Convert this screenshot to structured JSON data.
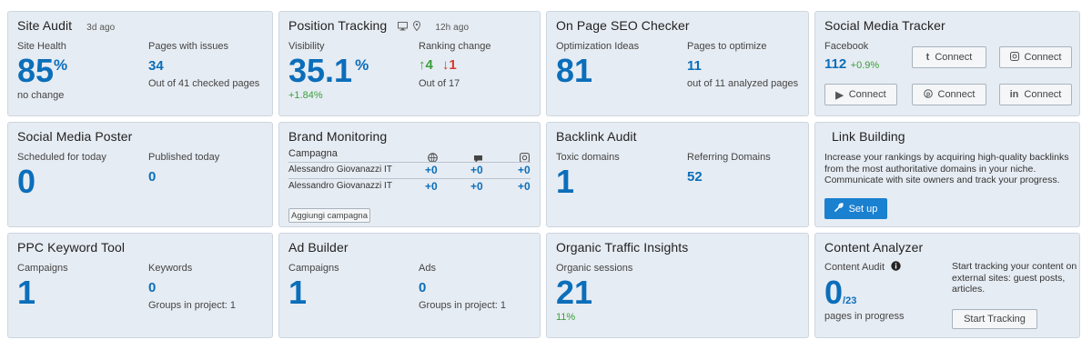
{
  "site_audit": {
    "title": "Site Audit",
    "meta": "3d ago",
    "health_label": "Site Health",
    "health_value": "85",
    "health_unit": "%",
    "health_change": "no change",
    "issues_label": "Pages with issues",
    "issues_value": "34",
    "issues_sub": "Out of 41 checked pages"
  },
  "position_tracking": {
    "title": "Position Tracking",
    "meta": "12h ago",
    "visibility_label": "Visibility",
    "visibility_value": "35.1",
    "visibility_unit": "%",
    "visibility_change": "+1.84%",
    "ranking_label": "Ranking change",
    "up_value": "4",
    "down_value": "1",
    "ranking_sub": "Out of 17"
  },
  "onpage": {
    "title": "On Page SEO Checker",
    "ideas_label": "Optimization Ideas",
    "ideas_value": "81",
    "pages_label": "Pages to optimize",
    "pages_value": "11",
    "pages_sub": "out of 11 analyzed pages"
  },
  "social_tracker": {
    "title": "Social Media Tracker",
    "facebook_label": "Facebook",
    "facebook_value": "112",
    "facebook_change": "+0.9%",
    "buttons": [
      "Connect",
      "Connect",
      "Connect",
      "Connect",
      "Connect"
    ]
  },
  "social_poster": {
    "title": "Social Media Poster",
    "scheduled_label": "Scheduled for today",
    "scheduled_value": "0",
    "published_label": "Published today",
    "published_value": "0"
  },
  "brand_monitoring": {
    "title": "Brand Monitoring",
    "column_label": "Campagna",
    "rows": [
      {
        "name": "Alessandro Giovanazzi IT",
        "v1": "+0",
        "v2": "+0",
        "v3": "+0"
      },
      {
        "name": "Alessandro Giovanazzi IT",
        "v1": "+0",
        "v2": "+0",
        "v3": "+0"
      }
    ],
    "add_button": "Aggiungi campagna"
  },
  "backlink": {
    "title": "Backlink Audit",
    "toxic_label": "Toxic domains",
    "toxic_value": "1",
    "ref_label": "Referring Domains",
    "ref_value": "52"
  },
  "link_building": {
    "title": "Link Building",
    "text": "Increase your rankings by acquiring high-quality backlinks from the most authoritative domains in your niche. Communicate with site owners and track your progress.",
    "button": "Set up"
  },
  "ppc": {
    "title": "PPC Keyword Tool",
    "campaigns_label": "Campaigns",
    "campaigns_value": "1",
    "keywords_label": "Keywords",
    "keywords_value": "0",
    "groups_sub": "Groups in project: 1"
  },
  "ad_builder": {
    "title": "Ad Builder",
    "campaigns_label": "Campaigns",
    "campaigns_value": "1",
    "ads_label": "Ads",
    "ads_value": "0",
    "groups_sub": "Groups in project: 1"
  },
  "organic": {
    "title": "Organic Traffic Insights",
    "sessions_label": "Organic sessions",
    "sessions_value": "21",
    "sessions_change": "11%"
  },
  "content_analyzer": {
    "title": "Content Analyzer",
    "audit_label": "Content Audit",
    "audit_value": "0",
    "audit_total": "/23",
    "audit_sub": "pages in progress",
    "promo": "Start tracking your content on external sites: guest posts, articles.",
    "button": "Start Tracking"
  },
  "colors": {
    "accent": "#0b6eba",
    "card_bg": "#e6ecf3",
    "positive": "#3a9f3a",
    "negative": "#d83a2f",
    "button_blue": "#1a80d0"
  }
}
